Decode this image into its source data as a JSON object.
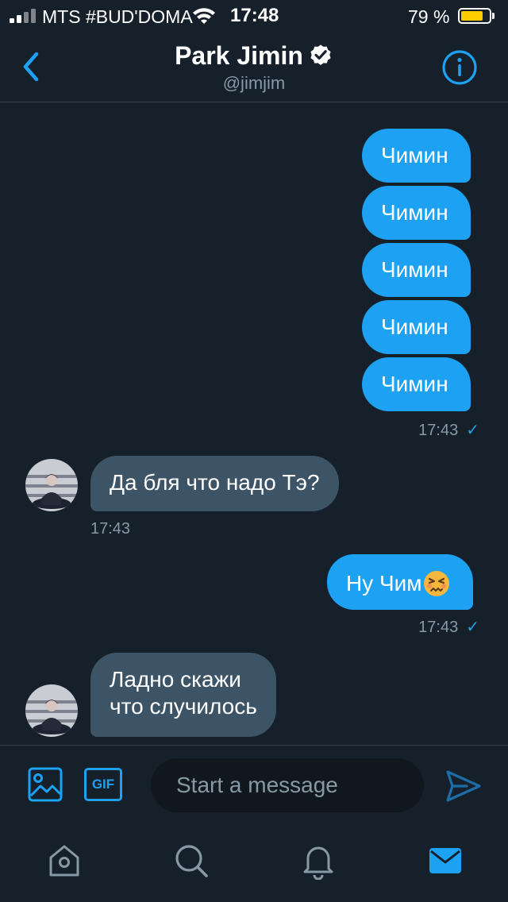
{
  "status_bar": {
    "carrier": "MTS #BUD'DOMA",
    "time": "17:48",
    "battery_percent": "79 %",
    "battery_level": 0.79,
    "battery_color": "#ffcc00"
  },
  "header": {
    "name": "Park Jimin",
    "handle": "@jimjim",
    "verified": true
  },
  "messages": [
    {
      "direction": "outgoing",
      "text": "Чимин"
    },
    {
      "direction": "outgoing",
      "text": "Чимин"
    },
    {
      "direction": "outgoing",
      "text": "Чимин"
    },
    {
      "direction": "outgoing",
      "text": "Чимин"
    },
    {
      "direction": "outgoing",
      "text": "Чимин",
      "time": "17:43",
      "status": "✓"
    },
    {
      "direction": "incoming",
      "text": "Да бля что надо Тэ?",
      "time": "17:43"
    },
    {
      "direction": "outgoing",
      "text": "Ну Чим",
      "emoji": "persevering-face",
      "time": "17:43",
      "status": "✓"
    },
    {
      "direction": "incoming",
      "lines": [
        "Ладно скажи",
        "что случилось"
      ]
    }
  ],
  "composer": {
    "placeholder": "Start a message",
    "gif_label": "GIF"
  },
  "tabs": [
    {
      "icon": "home-icon"
    },
    {
      "icon": "search-icon"
    },
    {
      "icon": "bell-icon"
    },
    {
      "icon": "mail-icon",
      "active": true
    }
  ],
  "colors": {
    "background": "#15202b",
    "accent": "#1da1f2",
    "incoming_bubble": "#3d5466",
    "muted_text": "#8899a6",
    "divider": "#38444d"
  }
}
